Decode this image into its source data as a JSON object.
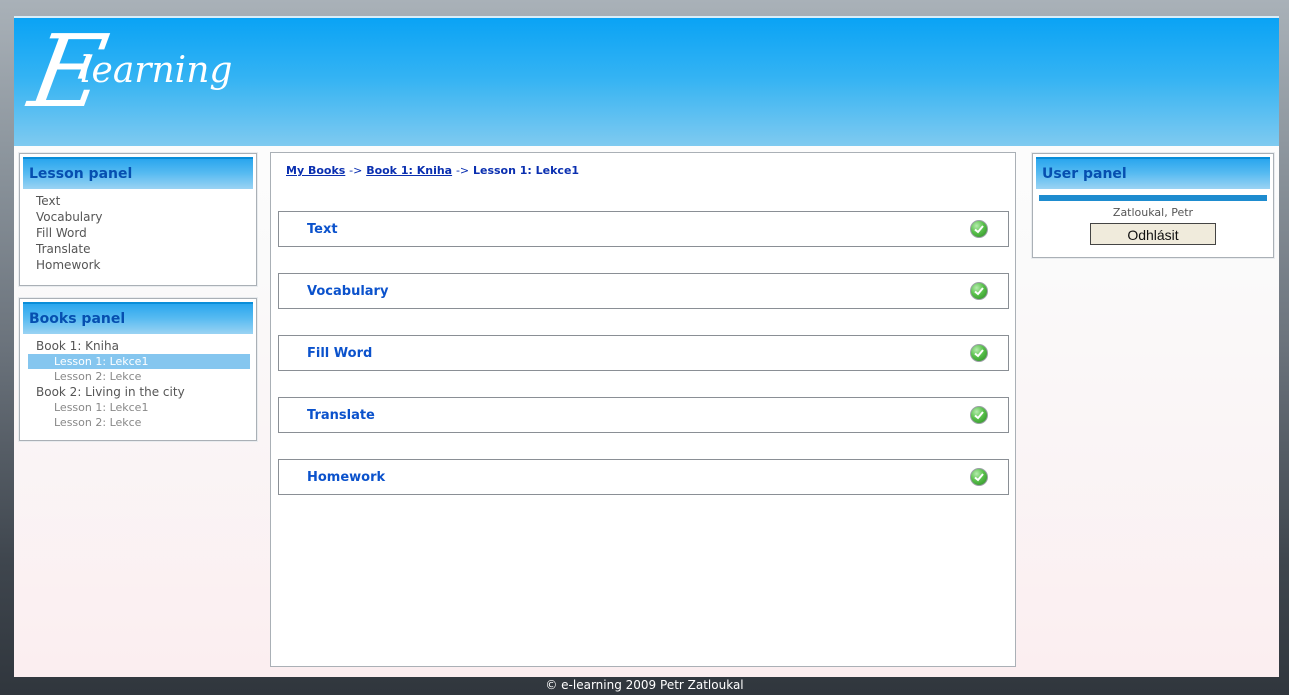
{
  "header": {
    "logo_big": "E",
    "logo_small": "learning"
  },
  "lesson_panel": {
    "title": "Lesson panel",
    "items": [
      "Text",
      "Vocabulary",
      "Fill Word",
      "Translate",
      "Homework"
    ]
  },
  "books_panel": {
    "title": "Books panel",
    "books": [
      {
        "title": "Book 1: Kniha",
        "lessons": [
          "Lesson 1: Lekce1",
          "Lesson 2: Lekce"
        ]
      },
      {
        "title": "Book 2: Living in the city",
        "lessons": [
          "Lesson 1: Lekce1",
          "Lesson 2: Lekce"
        ]
      }
    ]
  },
  "breadcrumb": {
    "my_books": "My Books",
    "sep": "->",
    "book": "Book 1: Kniha",
    "lesson": "Lesson 1: Lekce1"
  },
  "sections": [
    {
      "label": "Text",
      "status_icon": "check-icon"
    },
    {
      "label": "Vocabulary",
      "status_icon": "check-icon"
    },
    {
      "label": "Fill Word",
      "status_icon": "check-icon"
    },
    {
      "label": "Translate",
      "status_icon": "check-icon"
    },
    {
      "label": "Homework",
      "status_icon": "check-icon"
    }
  ],
  "user_panel": {
    "title": "User panel",
    "user_name": "Zatloukal, Petr",
    "logout_label": "Odhlásit"
  },
  "footer": {
    "text": "© e-learning 2009 Petr Zatloukal"
  },
  "colors": {
    "accent": "#0aa3f5",
    "panel_title": "#064fb0",
    "link": "#0b52cc",
    "active_item": "#85c6ef"
  }
}
